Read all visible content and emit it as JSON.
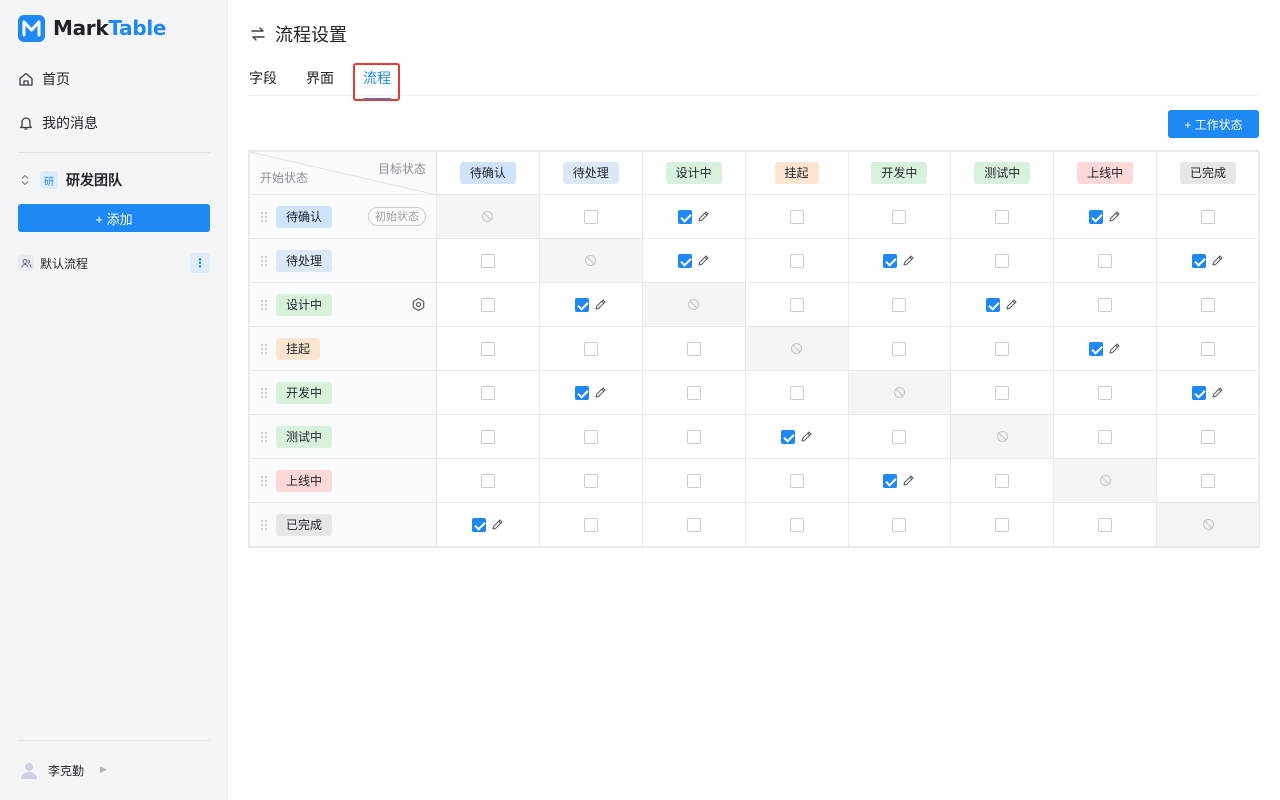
{
  "app": {
    "name_part1": "Mark",
    "name_part2": "Table"
  },
  "sidebar": {
    "nav": [
      {
        "label": "首页",
        "icon": "home-icon"
      },
      {
        "label": "我的消息",
        "icon": "bell-icon"
      }
    ],
    "team": {
      "badge": "研",
      "name": "研发团队"
    },
    "add_label": "+ 添加",
    "flow_item": "默认流程",
    "user": "李克勤"
  },
  "header": {
    "title": "流程设置"
  },
  "tabs": [
    {
      "label": "字段"
    },
    {
      "label": "界面"
    },
    {
      "label": "流程",
      "active": true
    }
  ],
  "toolbar": {
    "add_state_label": "+ 工作状态"
  },
  "matrix": {
    "corner_target": "目标状态",
    "corner_start": "开始状态",
    "initial_badge": "初始状态",
    "states": [
      {
        "name": "待确认",
        "bg": "#cfe3fb",
        "color": "#1f2329"
      },
      {
        "name": "待处理",
        "bg": "#dde8f6",
        "color": "#1f2329"
      },
      {
        "name": "设计中",
        "bg": "#d7f1dd",
        "color": "#1f2329"
      },
      {
        "name": "挂起",
        "bg": "#fde6cf",
        "color": "#1f2329"
      },
      {
        "name": "开发中",
        "bg": "#d7f1dd",
        "color": "#1f2329"
      },
      {
        "name": "测试中",
        "bg": "#d7f1dd",
        "color": "#1f2329"
      },
      {
        "name": "上线中",
        "bg": "#fdd8d8",
        "color": "#1f2329"
      },
      {
        "name": "已完成",
        "bg": "#e6e7e9",
        "color": "#1f2329"
      }
    ],
    "transitions": [
      [
        null,
        false,
        true,
        false,
        false,
        false,
        true,
        false
      ],
      [
        false,
        null,
        true,
        false,
        true,
        false,
        false,
        true
      ],
      [
        false,
        true,
        null,
        false,
        false,
        true,
        false,
        false
      ],
      [
        false,
        false,
        false,
        null,
        false,
        false,
        true,
        false
      ],
      [
        false,
        true,
        false,
        false,
        null,
        false,
        false,
        true
      ],
      [
        false,
        false,
        false,
        true,
        false,
        null,
        false,
        false
      ],
      [
        false,
        false,
        false,
        false,
        true,
        false,
        null,
        false
      ],
      [
        true,
        false,
        false,
        false,
        false,
        false,
        false,
        null
      ]
    ]
  }
}
